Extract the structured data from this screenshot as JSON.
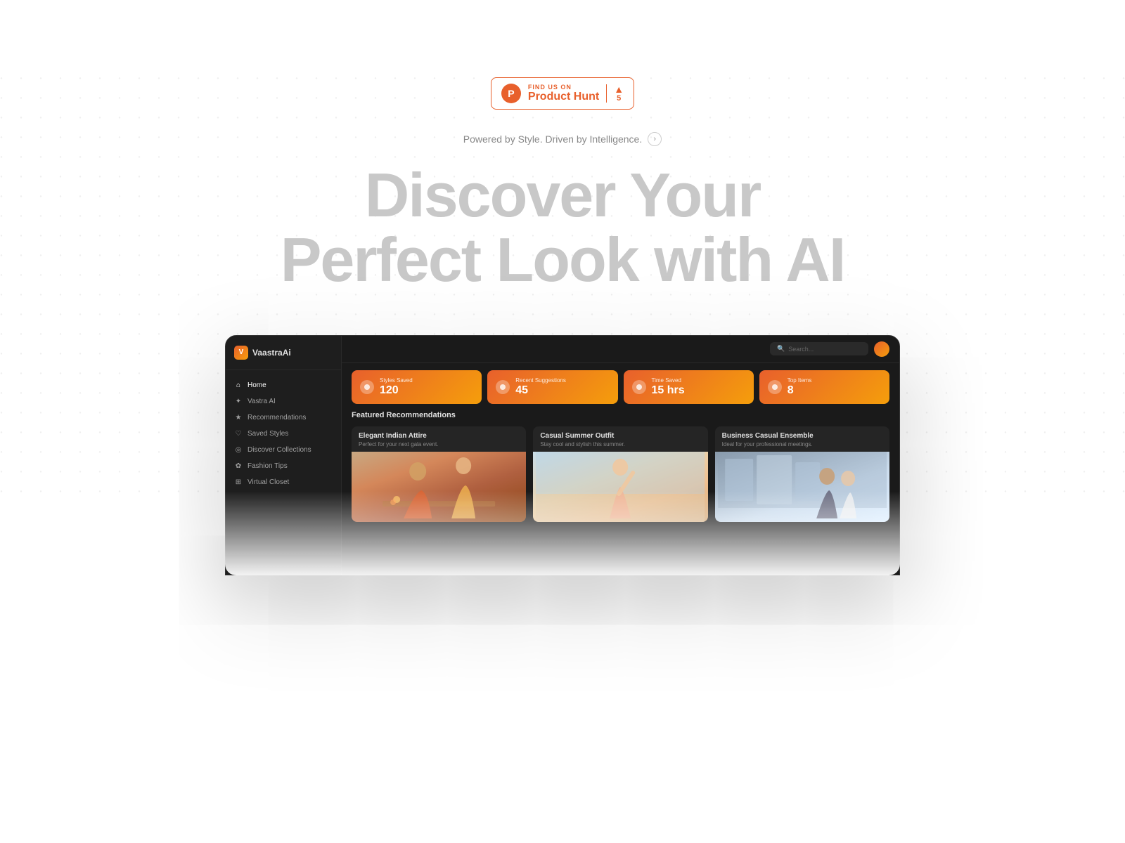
{
  "page": {
    "background": "#ffffff"
  },
  "product_hunt_badge": {
    "find_us_label": "FIND US ON",
    "product_hunt_name": "Product Hunt",
    "ph_icon_letter": "P",
    "vote_count": "5",
    "vote_arrow": "▲"
  },
  "tagline": {
    "text": "Powered by Style. Driven by Intelligence.",
    "arrow": "›"
  },
  "hero": {
    "heading_line1": "Discover Your",
    "heading_line2": "Perfect Look with AI"
  },
  "app_mockup": {
    "logo": {
      "icon": "V",
      "label": "VaastraAi"
    },
    "nav_items": [
      {
        "icon": "⌂",
        "label": "Home",
        "active": true
      },
      {
        "icon": "✦",
        "label": "Vastra AI",
        "active": false
      },
      {
        "icon": "★",
        "label": "Recommendations",
        "active": false
      },
      {
        "icon": "♡",
        "label": "Saved Styles",
        "active": false
      },
      {
        "icon": "◎",
        "label": "Discover Collections",
        "active": false
      },
      {
        "icon": "✿",
        "label": "Fashion Tips",
        "active": false
      },
      {
        "icon": "⊞",
        "label": "Virtual Closet",
        "active": false
      }
    ],
    "search": {
      "placeholder": "Search..."
    },
    "stats": [
      {
        "label": "Styles Saved",
        "value": "120"
      },
      {
        "label": "Recent Suggestions",
        "value": "45"
      },
      {
        "label": "Time Saved",
        "value": "15 hrs"
      },
      {
        "label": "Top Items",
        "value": "8"
      }
    ],
    "featured_section_title": "Featured Recommendations",
    "featured_cards": [
      {
        "title": "Elegant Indian Attire",
        "subtitle": "Perfect for your next gala event.",
        "image_type": "indian"
      },
      {
        "title": "Casual Summer Outfit",
        "subtitle": "Stay cool and stylish this summer.",
        "image_type": "summer"
      },
      {
        "title": "Business Casual Ensemble",
        "subtitle": "Ideal for your professional meetings.",
        "image_type": "business"
      }
    ]
  }
}
